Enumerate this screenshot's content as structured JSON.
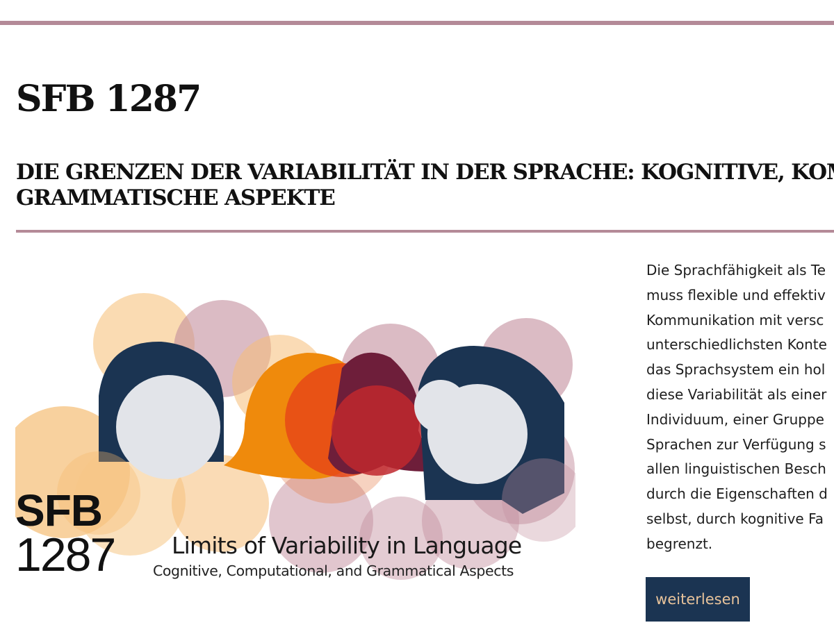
{
  "header": {
    "title": "SFB 1287",
    "subtitle_lines": [
      "DIE GRENZEN DER VARIABILITÄT IN DER SPRACHE: KOGNITIVE, KOMPUTATIONELLE UND",
      "GRAMMATISCHE ASPEKTE"
    ]
  },
  "colors": {
    "accent_rule": "#b48a98",
    "button_bg": "#1b3452",
    "button_text": "#e8c39b"
  },
  "logo": {
    "line_sfb": "SFB",
    "line_number": "1287",
    "title": "Limits of Variability in Language",
    "subtitle": "Cognitive, Computational, and Grammatical Aspects"
  },
  "intro": {
    "lines": [
      "Die Sprachfähigkeit als Te",
      "muss flexible und effektiv",
      "Kommunikation mit versc",
      "unterschiedlichsten Konte",
      "das Sprachsystem ein hol",
      "diese Variabilität als einer",
      "Individuum, einer Gruppe",
      "Sprachen zur Verfügung s",
      "allen linguistischen Besch",
      "durch die Eigenschaften d",
      "selbst, durch kognitive Fa",
      "begrenzt."
    ],
    "more_label": "weiterlesen"
  }
}
